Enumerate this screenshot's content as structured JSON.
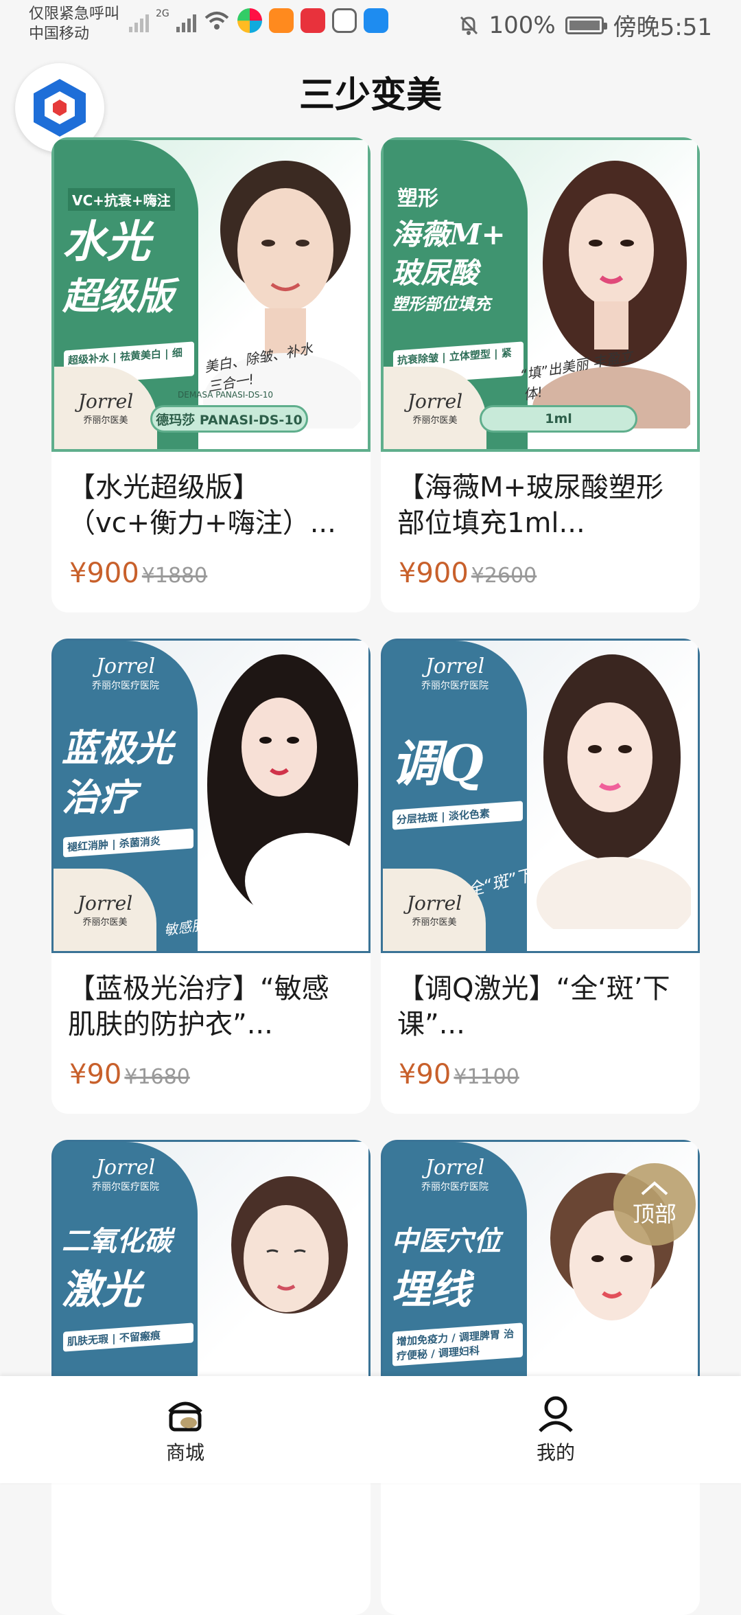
{
  "status_bar": {
    "carrier_line1": "仅限紧急呼叫",
    "carrier_line2": "中国移动",
    "network": "2G",
    "battery": "100%",
    "time": "傍晚5:51"
  },
  "header": {
    "title": "三少变美"
  },
  "products": [
    {
      "theme": "green",
      "image": {
        "tagline": "VC+抗衰+嗨注",
        "title_line1": "水光",
        "title_line2": "超级版",
        "sub": "超级补水 | 祛黄美白 | 细化毛孔",
        "handwriting": "美白、除皱、补水 三合一!",
        "pill_top": "DEMASA PANASI-DS-10",
        "pill": "德玛莎 PANASI-DS-10",
        "brand_script": "Jorrel",
        "brand_cn": "乔丽尔医美"
      },
      "title": "【水光超级版】（vc+衡力+嗨注）...",
      "price": "¥900",
      "original_price": "¥1880"
    },
    {
      "theme": "green",
      "image": {
        "tagline": "塑形",
        "title_line1": "海薇M+",
        "title_line2": "玻尿酸",
        "title_line3": "塑形部位填充",
        "sub": "抗衰除皱 | 立体塑型 | 紧致饱满",
        "handwriting": "“填”出美丽 丰盈立体!",
        "pill": "1ml",
        "brand_script": "Jorrel",
        "brand_cn": "乔丽尔医美"
      },
      "title": "【海薇M+玻尿酸塑形部位填充1ml...",
      "price": "¥900",
      "original_price": "¥2600"
    },
    {
      "theme": "blue",
      "image": {
        "brand_script": "Jorrel",
        "brand_top_cn": "乔丽尔医疗医院",
        "title_line1": "蓝极光",
        "title_line2": "治疗",
        "sub": "褪红消肿 | 杀菌消炎",
        "handwriting": "敏感肌肤的 防护衣!",
        "brand_cn": "乔丽尔医美"
      },
      "title": "【蓝极光治疗】“敏感肌肤的防护衣”...",
      "price": "¥90",
      "original_price": "¥1680"
    },
    {
      "theme": "blue",
      "image": {
        "brand_script": "Jorrel",
        "brand_top_cn": "乔丽尔医疗医院",
        "title_line1": "调Q",
        "sub": "分层祛斑 | 淡化色素",
        "handwriting": "全“斑”下课!",
        "brand_cn": "乔丽尔医美"
      },
      "title": "【调Q激光】“全‘斑’下课”...",
      "price": "¥90",
      "original_price": "¥1100"
    },
    {
      "theme": "blue",
      "image": {
        "brand_script": "Jorrel",
        "brand_top_cn": "乔丽尔医疗医院",
        "title_line1": "二氧化碳",
        "title_line2": "激光",
        "sub": "肌肤无瑕 | 不留瘢痕"
      },
      "title": "",
      "price": "",
      "original_price": ""
    },
    {
      "theme": "blue",
      "image": {
        "brand_script": "Jorrel",
        "brand_top_cn": "乔丽尔医疗医院",
        "title_line1": "中医穴位",
        "title_line2": "埋线",
        "sub": "增加免疫力 / 调理脾胃 治疗便秘 / 调理妇科"
      },
      "title": "",
      "price": "",
      "original_price": ""
    }
  ],
  "back_to_top": {
    "label": "顶部"
  },
  "tabbar": {
    "tabs": [
      {
        "label": "商城",
        "icon": "shop-icon",
        "active": true
      },
      {
        "label": "我的",
        "icon": "user-icon",
        "active": false
      }
    ]
  }
}
